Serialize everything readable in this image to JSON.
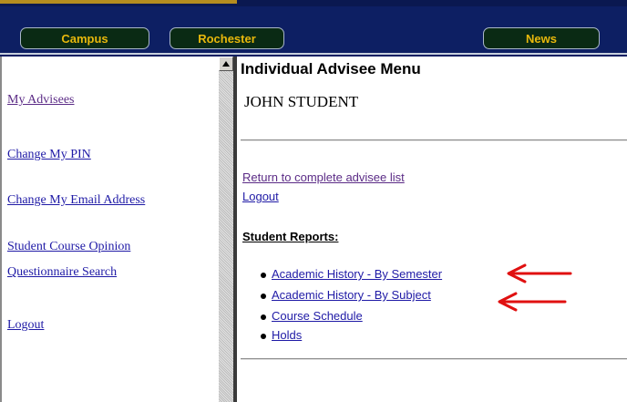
{
  "nav": {
    "campus": "Campus",
    "rochester": "Rochester",
    "news": "News"
  },
  "sidebar": {
    "items": [
      {
        "label": "My Advisees"
      },
      {
        "label": "Change My PIN"
      },
      {
        "label": "Change My Email Address"
      },
      {
        "label": "Student Course Opinion\nQuestionnaire Search"
      },
      {
        "label": "Logout"
      }
    ]
  },
  "main": {
    "title": "Individual Advisee Menu",
    "student_name": "JOHN STUDENT",
    "return_link": "Return to complete advisee list",
    "logout_link": "Logout",
    "reports_heading": "Student Reports:",
    "reports": [
      {
        "label": "Academic History - By Semester"
      },
      {
        "label": "Academic History - By Subject"
      },
      {
        "label": "Course Schedule"
      },
      {
        "label": "Holds"
      }
    ]
  },
  "colors": {
    "nav_background": "#0d1f63",
    "nav_button_text": "#e8b80c",
    "link": "#1f1aa6",
    "visited_link": "#5b2b86",
    "annotation_arrow": "#e01010"
  },
  "annotations": [
    {
      "icon": "red-arrow-icon",
      "points_to": "Academic History - By Semester"
    },
    {
      "icon": "red-arrow-icon",
      "points_to": "Academic History - By Subject"
    }
  ]
}
